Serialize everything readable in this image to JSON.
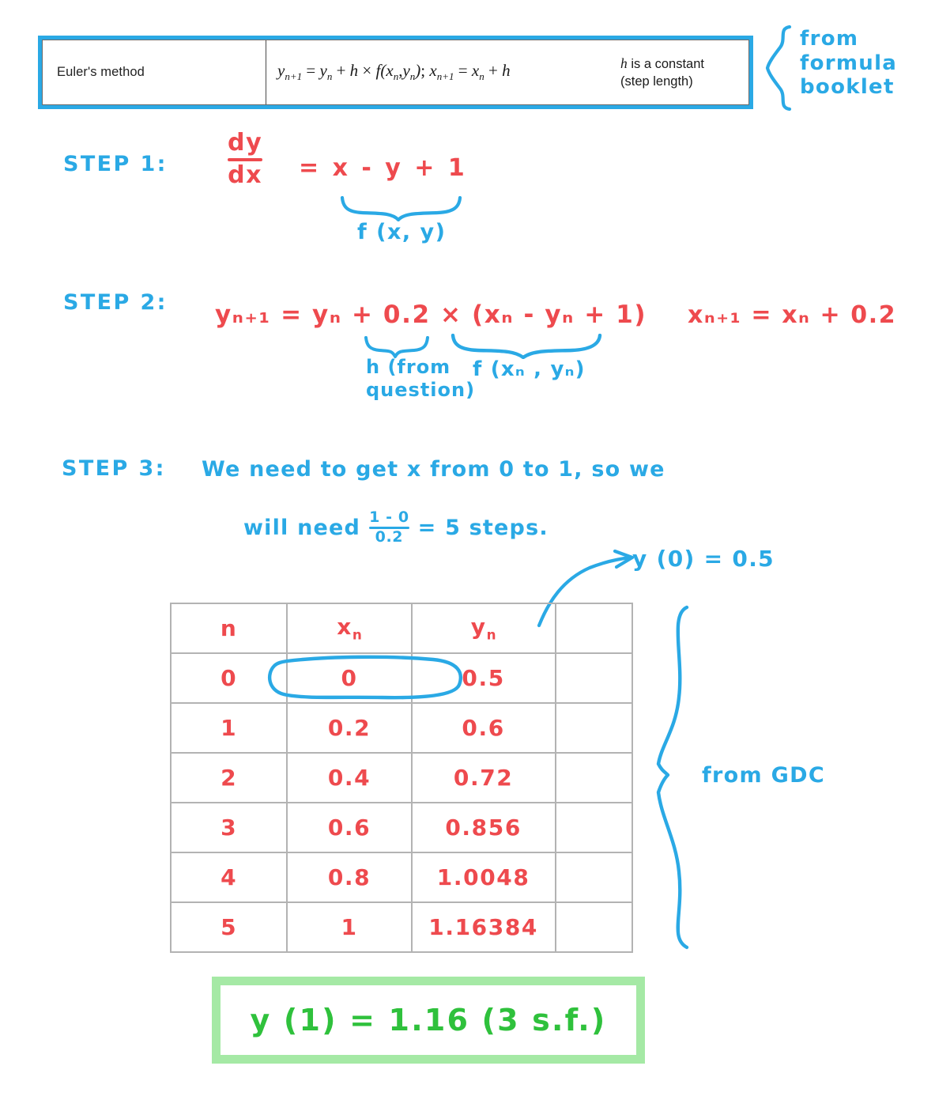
{
  "formula_box": {
    "method_name": "Euler's method",
    "equation": "y_{n+1} = y_n + h × f(x_n , y_n) ;  x_{n+1} = x_n + h",
    "equation_parts": {
      "y": "y",
      "sub_n1": "n+1",
      "sub_n": "n",
      "eq": "=",
      "plus": "+",
      "h": "h",
      "times": "×",
      "f": "f",
      "x": "x",
      "semi": ";"
    },
    "h_note_line1": "h is a constant",
    "h_note_line2": "(step length)",
    "source_note": "from\nformula\nbooklet",
    "source_note_lines": [
      "from",
      "formula",
      "booklet"
    ],
    "accent_color": "#2aa9e5"
  },
  "steps": {
    "step1": {
      "label": "STEP 1:",
      "numerator": "dy",
      "denominator": "dx",
      "rhs": "=  x - y + 1",
      "brace_label": "f (x, y)"
    },
    "step2": {
      "label": "STEP 2:",
      "equation": "yₙ₊₁ = yₙ + 0.2 × (xₙ - yₙ + 1)",
      "x_equation": "xₙ₊₁ = xₙ + 0.2",
      "h_brace_label_line1": "h (from",
      "h_brace_label_line2": "question)",
      "f_brace_label": "f (xₙ , yₙ)"
    },
    "step3": {
      "label": "STEP 3:",
      "line1": "We need to get x from 0 to 1, so we",
      "line2_prefix": "will need",
      "fraction_numerator": "1 - 0",
      "fraction_denominator": "0.2",
      "line2_suffix": "= 5 steps.",
      "initial_condition": "y (0) = 0.5"
    }
  },
  "table": {
    "headers": [
      "n",
      "x",
      "y",
      ""
    ],
    "header_subscripts": [
      "",
      "n",
      "n",
      ""
    ],
    "rows": [
      {
        "n": "0",
        "x": "0",
        "y": "0.5"
      },
      {
        "n": "1",
        "x": "0.2",
        "y": "0.6"
      },
      {
        "n": "2",
        "x": "0.4",
        "y": "0.72"
      },
      {
        "n": "3",
        "x": "0.6",
        "y": "0.856"
      },
      {
        "n": "4",
        "x": "0.8",
        "y": "1.0048"
      },
      {
        "n": "5",
        "x": "1",
        "y": "1.16384"
      }
    ],
    "gdc_note": "from GDC",
    "highlighted_row_index": 0
  },
  "answer": {
    "text": "y (1)  =  1.16  (3 s.f.)",
    "box_color": "#a5e9a5",
    "ink_color": "#2fc13c"
  },
  "colors": {
    "blue_ink": "#2aa9e5",
    "red_ink": "#ee4a4e",
    "green_ink": "#2fc13c",
    "table_grid": "#b3b3b3"
  },
  "chart_data": {
    "type": "table",
    "title": "Euler's method iteration table",
    "categories": [
      "n",
      "x_n",
      "y_n"
    ],
    "x": [
      0,
      1,
      2,
      3,
      4,
      5
    ],
    "series": [
      {
        "name": "x_n",
        "values": [
          0,
          0.2,
          0.4,
          0.6,
          0.8,
          1
        ]
      },
      {
        "name": "y_n",
        "values": [
          0.5,
          0.6,
          0.72,
          0.856,
          1.0048,
          1.16384
        ]
      }
    ],
    "xlabel": "n",
    "ylabel": "",
    "annotations": [
      "y(0) = 0.5",
      "from GDC",
      "y(1) = 1.16 (3 s.f.)"
    ],
    "grid": true,
    "legend": "none"
  }
}
